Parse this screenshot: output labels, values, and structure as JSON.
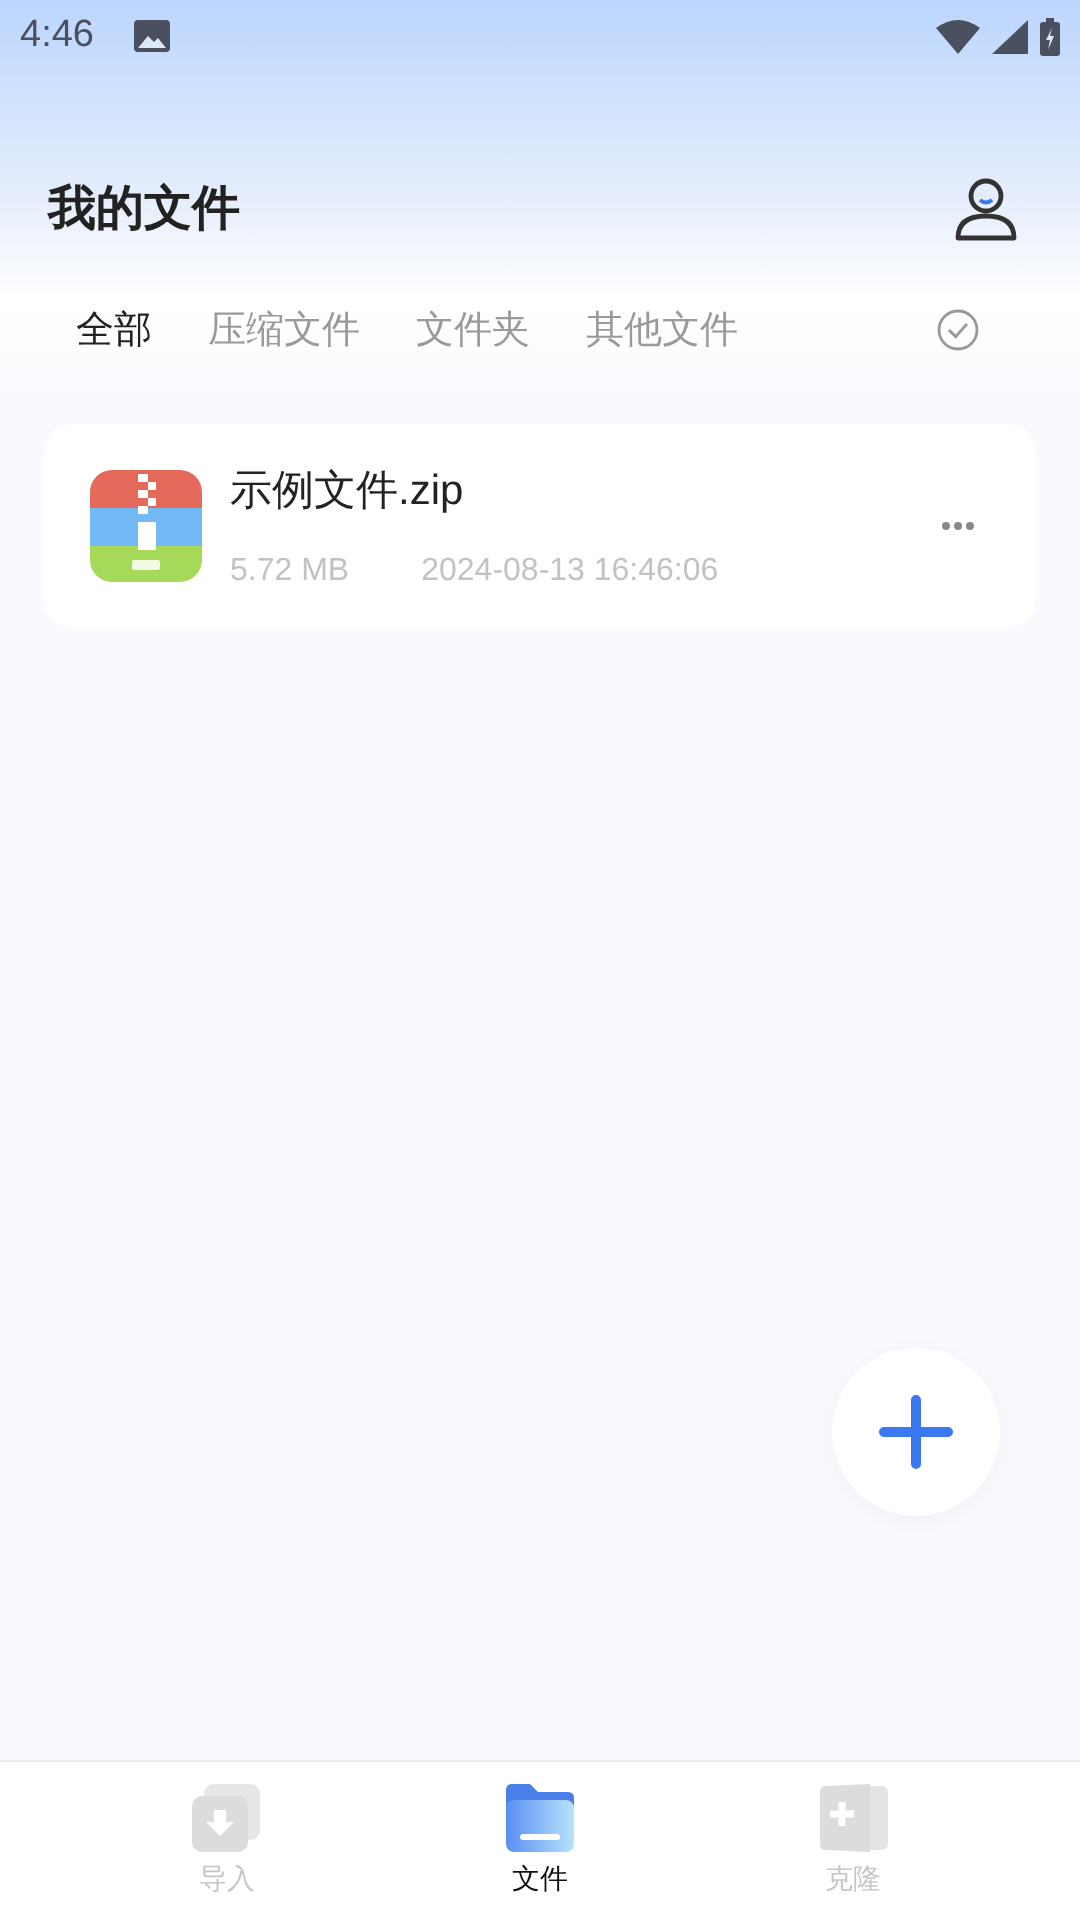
{
  "status_bar": {
    "time": "4:46"
  },
  "header": {
    "title": "我的文件"
  },
  "tabs": [
    {
      "label": "全部",
      "selected": true
    },
    {
      "label": "压缩文件",
      "selected": false
    },
    {
      "label": "文件夹",
      "selected": false
    },
    {
      "label": "其他文件",
      "selected": false
    }
  ],
  "files": [
    {
      "kind": "zip",
      "name": "示例文件.zip",
      "size": "5.72 MB",
      "date": "2024-08-13 16:46:06"
    }
  ],
  "bottom_nav": [
    {
      "kind": "import",
      "label": "导入",
      "selected": false
    },
    {
      "kind": "files",
      "label": "文件",
      "selected": true
    },
    {
      "kind": "clone",
      "label": "克隆",
      "selected": false
    }
  ]
}
